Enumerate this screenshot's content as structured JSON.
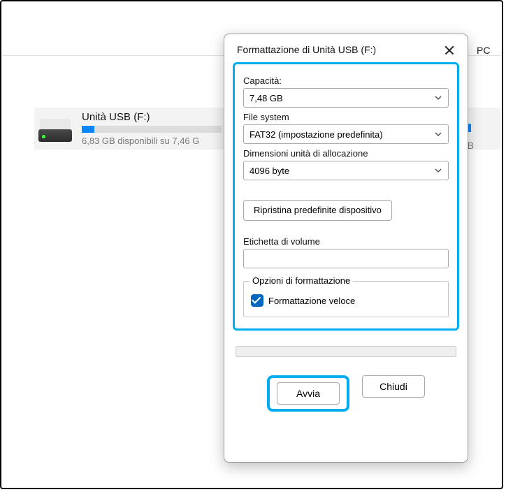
{
  "background": {
    "pc_label": "PC",
    "drive": {
      "title": "Unità USB (F:)",
      "subtitle": "6,83 GB disponibili su 7,46 G",
      "right_gb": "GB"
    }
  },
  "dialog": {
    "title": "Formattazione di Unità USB (F:)",
    "capacity": {
      "label": "Capacità:",
      "value": "7,48 GB"
    },
    "filesystem": {
      "label": "File system",
      "value": "FAT32 (impostazione predefinita)"
    },
    "allocation": {
      "label": "Dimensioni unità di allocazione",
      "value": "4096 byte"
    },
    "restore_defaults": "Ripristina predefinite dispositivo",
    "volume_label": {
      "label": "Etichetta di volume",
      "value": ""
    },
    "format_options": {
      "legend": "Opzioni di formattazione",
      "quick_format": "Formattazione veloce"
    },
    "buttons": {
      "start": "Avvia",
      "close": "Chiudi"
    }
  }
}
